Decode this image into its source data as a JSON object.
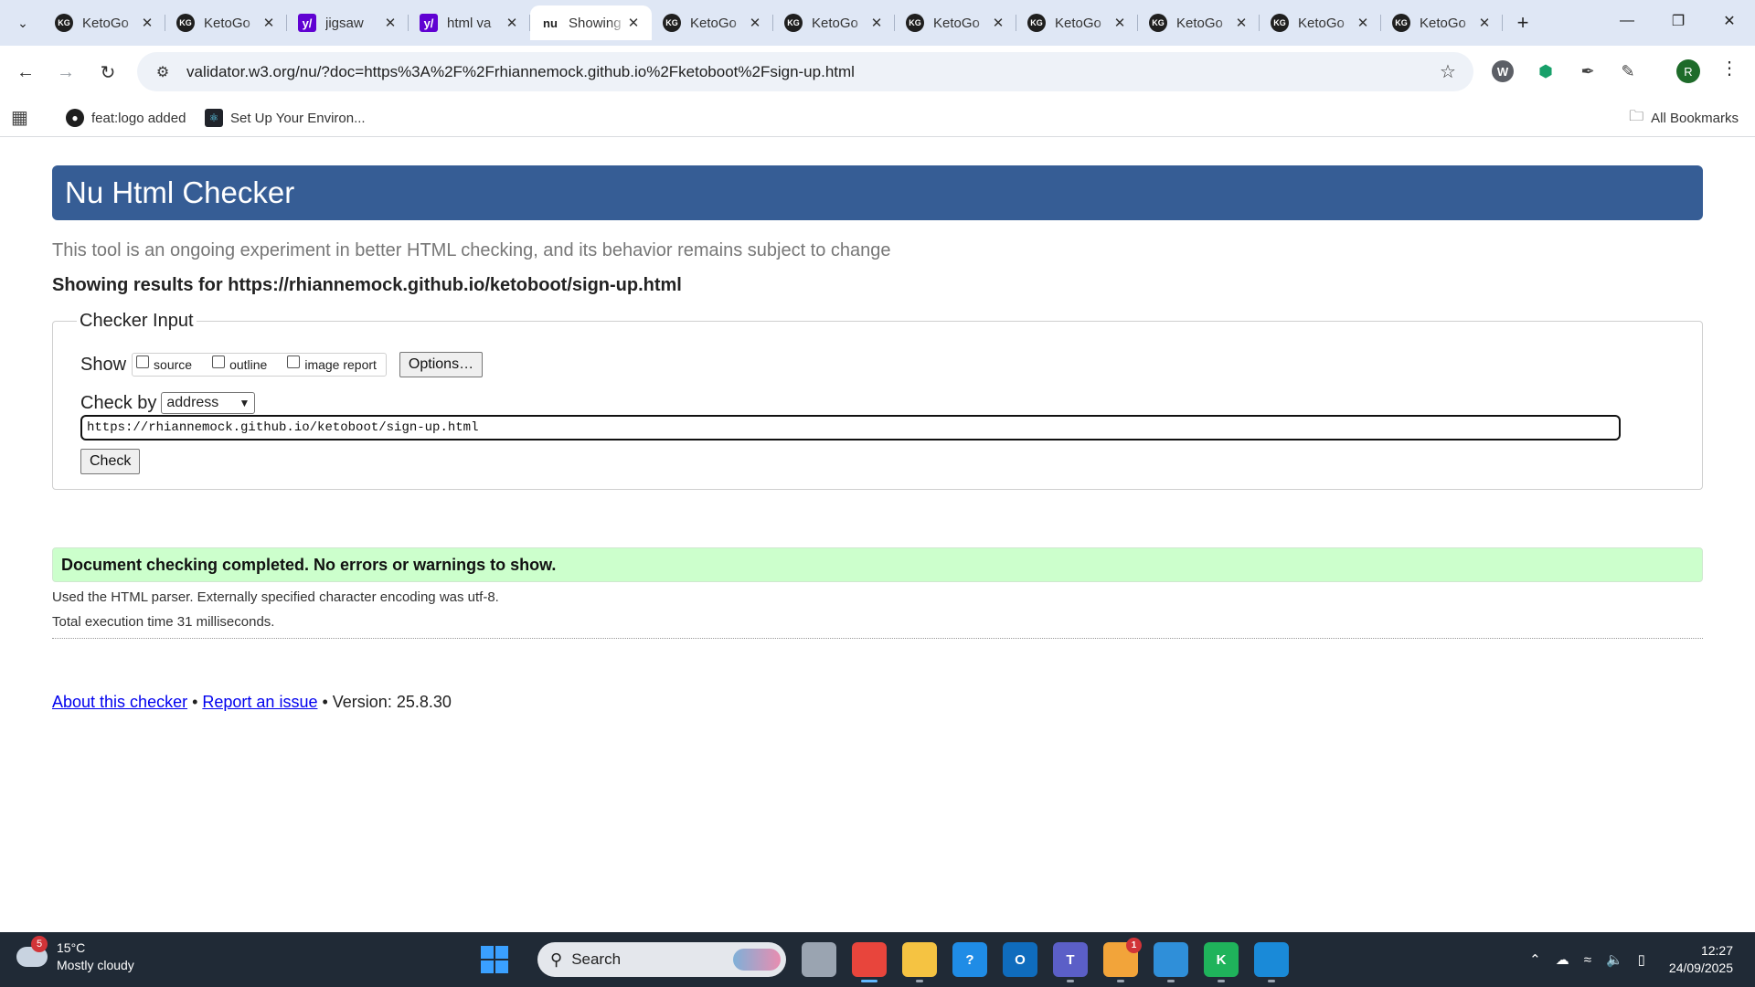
{
  "browser": {
    "tabs": [
      {
        "title": "KetoGo",
        "icon": "kg-icon",
        "active": false
      },
      {
        "title": "KetoGo",
        "icon": "kg-icon",
        "active": false
      },
      {
        "title": "jigsaw",
        "icon": "yahoo-icon",
        "active": false
      },
      {
        "title": "html va",
        "icon": "yahoo-icon",
        "active": false
      },
      {
        "title": "Showing",
        "icon": "nu-icon",
        "active": true
      },
      {
        "title": "KetoGo",
        "icon": "kg-icon",
        "active": false
      },
      {
        "title": "KetoGo",
        "icon": "kg-icon",
        "active": false
      },
      {
        "title": "KetoGo",
        "icon": "kg-icon",
        "active": false
      },
      {
        "title": "KetoGo",
        "icon": "kg-icon",
        "active": false
      },
      {
        "title": "KetoGo",
        "icon": "kg-icon",
        "active": false
      },
      {
        "title": "KetoGo",
        "icon": "kg-icon",
        "active": false
      },
      {
        "title": "KetoGo",
        "icon": "kg-icon",
        "active": false
      }
    ],
    "favicon_kg": "KG",
    "favicon_yahoo": "y/",
    "favicon_nu": "nu",
    "url": "validator.w3.org/nu/?doc=https%3A%2F%2Frhiannemock.github.io%2Fketoboot%2Fsign-up.html",
    "avatar_letter": "R",
    "bookmarks": [
      {
        "label": "feat:logo added",
        "icon": "github-icon"
      },
      {
        "label": "Set Up Your Environ...",
        "icon": "react-icon"
      }
    ],
    "all_bookmarks": "All Bookmarks"
  },
  "page": {
    "title": "Nu Html Checker",
    "tagline": "This tool is an ongoing experiment in better HTML checking, and its behavior remains subject to change",
    "showing": "Showing results for https://rhiannemock.github.io/ketoboot/sign-up.html",
    "checker": {
      "legend": "Checker Input",
      "show_label": "Show",
      "show_options": [
        "source",
        "outline",
        "image report"
      ],
      "options_button": "Options…",
      "check_by_label": "Check by",
      "check_by_value": "address",
      "url_value": "https://rhiannemock.github.io/ketoboot/sign-up.html",
      "check_button": "Check"
    },
    "result": "Document checking completed. No errors or warnings to show.",
    "info_parser": "Used the HTML parser. Externally specified character encoding was utf-8.",
    "info_time": "Total execution time 31 milliseconds.",
    "footer": {
      "about": "About this checker",
      "report": "Report an issue",
      "separator": "•",
      "version": "Version: 25.8.30"
    },
    "colors": {
      "header_bg": "#365d95",
      "success_bg": "#ccffcc",
      "link": "#0000ee"
    }
  },
  "taskbar": {
    "weather_badge": "5",
    "temperature": "15°C",
    "condition": "Mostly cloudy",
    "search_label": "Search",
    "apps": [
      {
        "name": "task-view",
        "label": "",
        "color": "#9aa4b1",
        "state": "none"
      },
      {
        "name": "chrome",
        "label": "",
        "color": "#e8453c",
        "state": "active"
      },
      {
        "name": "file-explorer",
        "label": "",
        "color": "#f5c342",
        "state": "open"
      },
      {
        "name": "help",
        "label": "?",
        "color": "#1f8ce6",
        "state": "none"
      },
      {
        "name": "outlook",
        "label": "O",
        "color": "#0f6cbd",
        "state": "none"
      },
      {
        "name": "teams",
        "label": "T",
        "color": "#5b5fc7",
        "state": "open"
      },
      {
        "name": "discord",
        "label": "",
        "color": "#f2a43a",
        "state": "open",
        "badge": "1"
      },
      {
        "name": "notepad",
        "label": "",
        "color": "#2f8fd9",
        "state": "open"
      },
      {
        "name": "kotlin",
        "label": "K",
        "color": "#1fb35b",
        "state": "open"
      },
      {
        "name": "vscode",
        "label": "",
        "color": "#1a8ad8",
        "state": "open"
      }
    ],
    "time": "12:27",
    "date": "24/09/2025"
  }
}
